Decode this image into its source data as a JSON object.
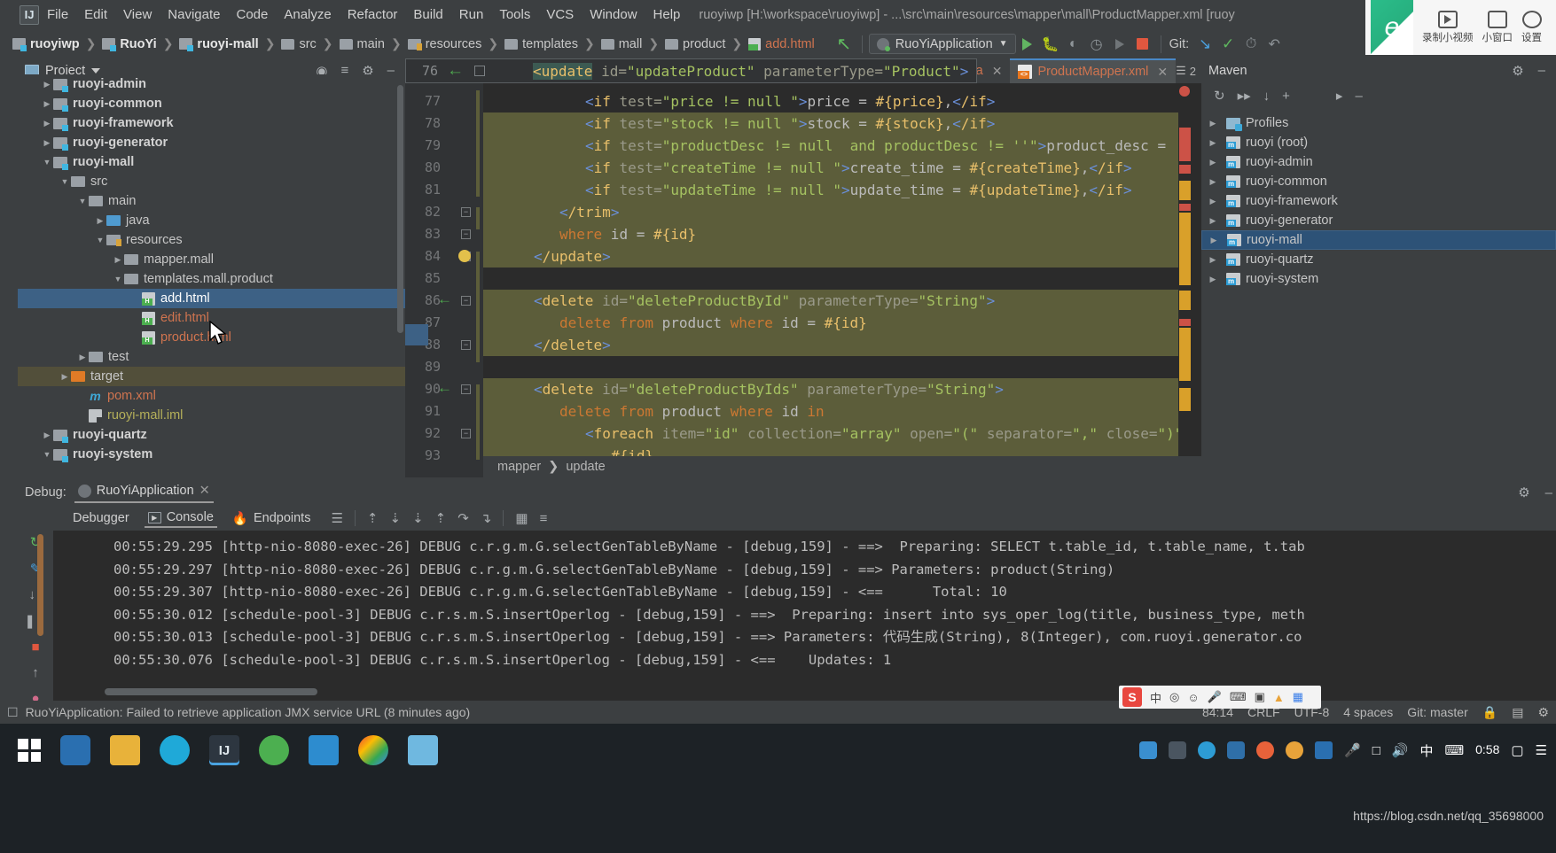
{
  "window": {
    "title": "ruoyiwp [H:\\workspace\\ruoyiwp] - ...\\src\\main\\resources\\mapper\\mall\\ProductMapper.xml [ruoy",
    "logo": "IJ"
  },
  "menubar": {
    "items": [
      "File",
      "Edit",
      "View",
      "Navigate",
      "Code",
      "Analyze",
      "Refactor",
      "Build",
      "Run",
      "Tools",
      "VCS",
      "Window",
      "Help"
    ]
  },
  "navbar": {
    "breadcrumbs": [
      {
        "label": "ruoyiwp",
        "icon": "module-icon",
        "bold": true
      },
      {
        "label": "RuoYi",
        "icon": "module-icon",
        "bold": true
      },
      {
        "label": "ruoyi-mall",
        "icon": "module-icon",
        "bold": true
      },
      {
        "label": "src",
        "icon": "folder-icon",
        "bold": false
      },
      {
        "label": "main",
        "icon": "folder-icon",
        "bold": false
      },
      {
        "label": "resources",
        "icon": "resources-folder-icon",
        "bold": false
      },
      {
        "label": "templates",
        "icon": "folder-icon",
        "bold": false
      },
      {
        "label": "mall",
        "icon": "folder-icon",
        "bold": false
      },
      {
        "label": "product",
        "icon": "folder-icon",
        "bold": false
      },
      {
        "label": "add.html",
        "icon": "html-file-icon",
        "bold": false
      }
    ],
    "run_config": "RuoYiApplication",
    "git_label": "Git:"
  },
  "project_panel": {
    "title": "Project",
    "items": [
      {
        "label": "ruoyi-admin",
        "depth": 1,
        "arrow": "▶",
        "icon": "module-icon",
        "style": "bold",
        "state": "partial"
      },
      {
        "label": "ruoyi-common",
        "depth": 1,
        "arrow": "▶",
        "icon": "module-icon",
        "style": "bold"
      },
      {
        "label": "ruoyi-framework",
        "depth": 1,
        "arrow": "▶",
        "icon": "module-icon",
        "style": "bold"
      },
      {
        "label": "ruoyi-generator",
        "depth": 1,
        "arrow": "▶",
        "icon": "module-icon",
        "style": "bold"
      },
      {
        "label": "ruoyi-mall",
        "depth": 1,
        "arrow": "▼",
        "icon": "module-icon",
        "style": "bold"
      },
      {
        "label": "src",
        "depth": 2,
        "arrow": "▼",
        "icon": "folder-grey-icon",
        "style": "normal"
      },
      {
        "label": "main",
        "depth": 3,
        "arrow": "▼",
        "icon": "folder-grey-icon",
        "style": "normal"
      },
      {
        "label": "java",
        "depth": 4,
        "arrow": "▶",
        "icon": "folder-blue-icon",
        "style": "normal"
      },
      {
        "label": "resources",
        "depth": 4,
        "arrow": "▼",
        "icon": "resources-folder-icon",
        "style": "normal"
      },
      {
        "label": "mapper.mall",
        "depth": 5,
        "arrow": "▶",
        "icon": "folder-grey-icon",
        "style": "normal"
      },
      {
        "label": "templates.mall.product",
        "depth": 5,
        "arrow": "▼",
        "icon": "folder-grey-icon",
        "style": "normal"
      },
      {
        "label": "add.html",
        "depth": 6,
        "arrow": "",
        "icon": "html-file-icon",
        "style": "selected",
        "selected": true
      },
      {
        "label": "edit.html",
        "depth": 6,
        "arrow": "",
        "icon": "html-file-icon",
        "style": "red"
      },
      {
        "label": "product.html",
        "depth": 6,
        "arrow": "",
        "icon": "html-file-icon",
        "style": "red"
      },
      {
        "label": "test",
        "depth": 3,
        "arrow": "▶",
        "icon": "folder-grey-icon",
        "style": "normal"
      },
      {
        "label": "target",
        "depth": 2,
        "arrow": "▶",
        "icon": "folder-orange-icon",
        "style": "normal",
        "highlight": true
      },
      {
        "label": "pom.xml",
        "depth": 3,
        "arrow": "",
        "icon": "maven-m-icon",
        "style": "red"
      },
      {
        "label": "ruoyi-mall.iml",
        "depth": 3,
        "arrow": "",
        "icon": "iml-file-icon",
        "style": "yellow"
      },
      {
        "label": "ruoyi-quartz",
        "depth": 1,
        "arrow": "▶",
        "icon": "module-icon",
        "style": "bold"
      },
      {
        "label": "ruoyi-system",
        "depth": 1,
        "arrow": "▼",
        "icon": "module-icon",
        "style": "bold"
      }
    ]
  },
  "editor": {
    "tabs": [
      {
        "label": "a",
        "icon": "",
        "active": false,
        "truncated": true
      },
      {
        "label": "ProductMapper.xml",
        "icon": "xml-file-icon",
        "active": true
      }
    ],
    "tab_count": "2",
    "breadcrumb": [
      "mapper",
      "update"
    ],
    "floating_line": {
      "number": "76",
      "text": "<update id=\"updateProduct\" parameterType=\"Product\">"
    },
    "lines": [
      {
        "n": "77",
        "text": "<if test=\"price != null \">price = #{price},</if>",
        "indent": 3,
        "hl": false
      },
      {
        "n": "78",
        "text": "<if test=\"stock != null \">stock = #{stock},</if>",
        "indent": 3,
        "hl": true
      },
      {
        "n": "79",
        "text": "<if test=\"productDesc != null  and productDesc != ''\">product_desc =",
        "indent": 3,
        "hl": true
      },
      {
        "n": "80",
        "text": "<if test=\"createTime != null \">create_time = #{createTime},</if>",
        "indent": 3,
        "hl": true
      },
      {
        "n": "81",
        "text": "<if test=\"updateTime != null \">update_time = #{updateTime},</if>",
        "indent": 3,
        "hl": true
      },
      {
        "n": "82",
        "text": "</trim>",
        "indent": 2,
        "hl": true,
        "fold": true
      },
      {
        "n": "83",
        "text": "where id = #{id}",
        "indent": 2,
        "hl": true,
        "fold": true
      },
      {
        "n": "84",
        "text": "</update>",
        "indent": 1,
        "hl": true,
        "fold": true,
        "bulb": true
      },
      {
        "n": "85",
        "text": "",
        "indent": 0,
        "hl": false
      },
      {
        "n": "86",
        "text": "<delete id=\"deleteProductById\" parameterType=\"String\">",
        "indent": 1,
        "hl": true,
        "arrow": true,
        "fold": true
      },
      {
        "n": "87",
        "text": "delete from product where id = #{id}",
        "indent": 2,
        "hl": true
      },
      {
        "n": "88",
        "text": "</delete>",
        "indent": 1,
        "hl": true,
        "fold": true
      },
      {
        "n": "89",
        "text": "",
        "indent": 0,
        "hl": false
      },
      {
        "n": "90",
        "text": "<delete id=\"deleteProductByIds\" parameterType=\"String\">",
        "indent": 1,
        "hl": true,
        "arrow": true,
        "fold": true
      },
      {
        "n": "91",
        "text": "delete from product where id in",
        "indent": 2,
        "hl": true
      },
      {
        "n": "92",
        "text": "<foreach item=\"id\" collection=\"array\" open=\"(\" separator=\",\" close=\")\">",
        "indent": 3,
        "hl": true,
        "fold": true
      },
      {
        "n": "93",
        "text": "#{id}",
        "indent": 4,
        "hl": true
      }
    ]
  },
  "maven_panel": {
    "title": "Maven",
    "items": [
      {
        "label": "Profiles",
        "icon": "profiles-icon",
        "arrow": "▶"
      },
      {
        "label": "ruoyi (root)",
        "icon": "maven-module-icon",
        "arrow": "▶"
      },
      {
        "label": "ruoyi-admin",
        "icon": "maven-module-icon",
        "arrow": "▶"
      },
      {
        "label": "ruoyi-common",
        "icon": "maven-module-icon",
        "arrow": "▶"
      },
      {
        "label": "ruoyi-framework",
        "icon": "maven-module-icon",
        "arrow": "▶"
      },
      {
        "label": "ruoyi-generator",
        "icon": "maven-module-icon",
        "arrow": "▶"
      },
      {
        "label": "ruoyi-mall",
        "icon": "maven-module-icon",
        "arrow": "▶",
        "selected": true
      },
      {
        "label": "ruoyi-quartz",
        "icon": "maven-module-icon",
        "arrow": "▶"
      },
      {
        "label": "ruoyi-system",
        "icon": "maven-module-icon",
        "arrow": "▶"
      }
    ]
  },
  "debug_panel": {
    "label": "Debug:",
    "session": "RuoYiApplication",
    "tabs": [
      {
        "label": "Debugger",
        "icon": "",
        "active": false
      },
      {
        "label": "Console",
        "icon": "console-icon",
        "active": true
      },
      {
        "label": "Endpoints",
        "icon": "endpoints-icon",
        "active": false
      }
    ],
    "log_lines": [
      "00:55:29.295 [http-nio-8080-exec-26] DEBUG c.r.g.m.G.selectGenTableByName - [debug,159] - ==>  Preparing: SELECT t.table_id, t.table_name, t.tab",
      "00:55:29.297 [http-nio-8080-exec-26] DEBUG c.r.g.m.G.selectGenTableByName - [debug,159] - ==> Parameters: product(String)",
      "00:55:29.307 [http-nio-8080-exec-26] DEBUG c.r.g.m.G.selectGenTableByName - [debug,159] - <==      Total: 10",
      "00:55:30.012 [schedule-pool-3] DEBUG c.r.s.m.S.insertOperlog - [debug,159] - ==>  Preparing: insert into sys_oper_log(title, business_type, meth",
      "00:55:30.013 [schedule-pool-3] DEBUG c.r.s.m.S.insertOperlog - [debug,159] - ==> Parameters: 代码生成(String), 8(Integer), com.ruoyi.generator.co",
      "00:55:30.076 [schedule-pool-3] DEBUG c.r.s.m.S.insertOperlog - [debug,159] - <==    Updates: 1"
    ]
  },
  "statusbar": {
    "message": "RuoYiApplication: Failed to retrieve application JMX service URL (8 minutes ago)",
    "caret": "84:14",
    "line_sep": "CRLF",
    "encoding": "UTF-8",
    "indent": "4 spaces",
    "git_branch": "Git: master"
  },
  "ime": {
    "logo": "S",
    "mode": "中",
    "items": [
      "中",
      "•",
      "☺",
      "mic",
      "keyboard",
      "box",
      "up",
      "grid"
    ]
  },
  "taskbar": {
    "clock_time": "0:58",
    "watermark": "https://blog.csdn.net/qq_35698000"
  },
  "overlay_buttons": [
    {
      "label": "录制小视频",
      "icon": "camera-icon"
    },
    {
      "label": "小窗口",
      "icon": "window-icon"
    },
    {
      "label": "设置",
      "icon": "gear-icon"
    }
  ]
}
